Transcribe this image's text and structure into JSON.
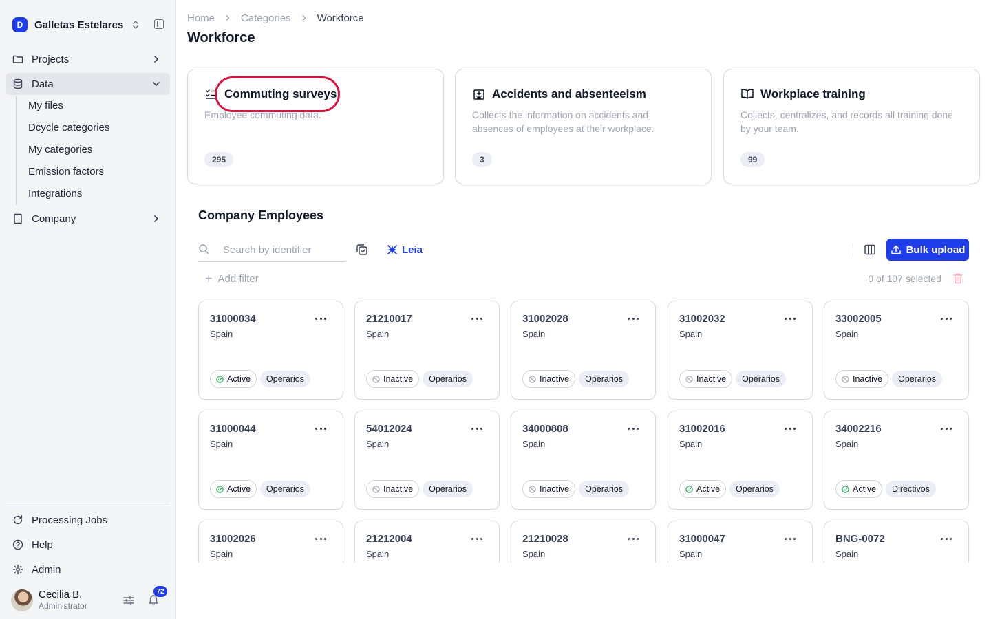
{
  "sidebar": {
    "org_initial": "D",
    "org_name": "Galletas Estelares",
    "items": [
      {
        "label": "Projects",
        "icon": "folder-icon"
      },
      {
        "label": "Data",
        "icon": "database-icon"
      },
      {
        "label": "Company",
        "icon": "building-icon"
      }
    ],
    "data_sub_items": [
      "My files",
      "Dcycle categories",
      "My categories",
      "Emission factors",
      "Integrations"
    ],
    "bottom_items": [
      {
        "label": "Processing Jobs",
        "icon": "refresh-icon"
      },
      {
        "label": "Help",
        "icon": "help-icon"
      },
      {
        "label": "Admin",
        "icon": "gear-icon"
      }
    ],
    "user": {
      "name": "Cecilia B.",
      "role": "Administrator",
      "notifications": "72"
    }
  },
  "breadcrumb": [
    "Home",
    "Categories",
    "Workforce"
  ],
  "page_title": "Workforce",
  "categories": [
    {
      "title": "Commuting surveys",
      "description": "Employee commuting data.",
      "count": "295",
      "icon": "checklist-icon"
    },
    {
      "title": "Accidents and absenteeism",
      "description": "Collects the information on accidents and absences of employees at their workplace.",
      "count": "3",
      "icon": "hospital-icon"
    },
    {
      "title": "Workplace training",
      "description": "Collects, centralizes, and records all training done by your team.",
      "count": "99",
      "icon": "book-icon"
    }
  ],
  "employees_section": {
    "title": "Company Employees",
    "search_placeholder": "Search by identifier",
    "leia_label": "Leia",
    "bulk_upload_label": "Bulk upload",
    "add_filter_label": "Add filter",
    "selected_text": "0 of 107 selected"
  },
  "colors": {
    "accent": "#1f3de8",
    "highlight": "#d5133f",
    "active": "#16a34a"
  },
  "employees": [
    {
      "id": "31000034",
      "country": "Spain",
      "status": "Active",
      "role": "Operarios"
    },
    {
      "id": "21210017",
      "country": "Spain",
      "status": "Inactive",
      "role": "Operarios"
    },
    {
      "id": "31002028",
      "country": "Spain",
      "status": "Inactive",
      "role": "Operarios"
    },
    {
      "id": "31002032",
      "country": "Spain",
      "status": "Inactive",
      "role": "Operarios"
    },
    {
      "id": "33002005",
      "country": "Spain",
      "status": "Inactive",
      "role": "Operarios"
    },
    {
      "id": "31000044",
      "country": "Spain",
      "status": "Active",
      "role": "Operarios"
    },
    {
      "id": "54012024",
      "country": "Spain",
      "status": "Inactive",
      "role": "Operarios"
    },
    {
      "id": "34000808",
      "country": "Spain",
      "status": "Inactive",
      "role": "Operarios"
    },
    {
      "id": "31002016",
      "country": "Spain",
      "status": "Active",
      "role": "Operarios"
    },
    {
      "id": "34002216",
      "country": "Spain",
      "status": "Active",
      "role": "Directivos"
    },
    {
      "id": "31002026",
      "country": "Spain",
      "status": "",
      "role": ""
    },
    {
      "id": "21212004",
      "country": "Spain",
      "status": "",
      "role": ""
    },
    {
      "id": "21210028",
      "country": "Spain",
      "status": "",
      "role": ""
    },
    {
      "id": "31000047",
      "country": "Spain",
      "status": "",
      "role": ""
    },
    {
      "id": "BNG-0072",
      "country": "Spain",
      "status": "",
      "role": ""
    }
  ]
}
